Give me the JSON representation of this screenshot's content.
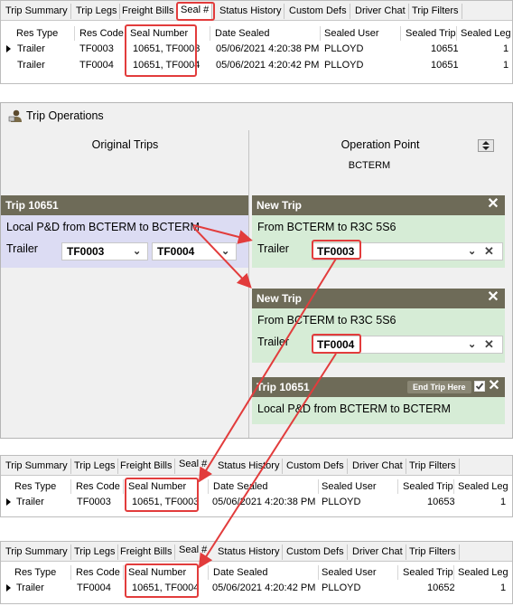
{
  "tabs": [
    "Trip Summary",
    "Trip Legs",
    "Freight Bills",
    "Seal #",
    "Status History",
    "Custom Defs",
    "Driver Chat",
    "Trip Filters"
  ],
  "columns": [
    "Res Type",
    "Res Code",
    "Seal Number",
    "Date Sealed",
    "Sealed User",
    "Sealed Trip",
    "Sealed Leg"
  ],
  "top_grid": {
    "rows": [
      {
        "res_type": "Trailer",
        "res_code": "TF0003",
        "seal_number": "10651, TF0003",
        "date_sealed": "05/06/2021 4:20:38 PM",
        "sealed_user": "PLLOYD",
        "sealed_trip": "10651",
        "sealed_leg": "1"
      },
      {
        "res_type": "Trailer",
        "res_code": "TF0004",
        "seal_number": "10651, TF0004",
        "date_sealed": "05/06/2021 4:20:42 PM",
        "sealed_user": "PLLOYD",
        "sealed_trip": "10651",
        "sealed_leg": "1"
      }
    ]
  },
  "trip_operations": {
    "title": "Trip Operations",
    "original_trips_heading": "Original Trips",
    "operation_point_heading": "Operation Point",
    "operation_point_value": "BCTERM",
    "original_trip": {
      "title": "Trip 10651",
      "route": "Local P&D from BCTERM to BCTERM",
      "res_label": "Trailer",
      "trailer_a": "TF0003",
      "trailer_b": "TF0004"
    },
    "new_trip_1": {
      "title": "New Trip",
      "route": "From BCTERM to R3C 5S6",
      "res_label": "Trailer",
      "trailer": "TF0003"
    },
    "new_trip_2": {
      "title": "New Trip",
      "route": "From BCTERM to R3C 5S6",
      "res_label": "Trailer",
      "trailer": "TF0004"
    },
    "end_trip": {
      "title": "Trip 10651",
      "end_trip_here_label": "End Trip Here",
      "route": "Local P&D from BCTERM to BCTERM"
    }
  },
  "grid2": {
    "row": {
      "res_type": "Trailer",
      "res_code": "TF0003",
      "seal_number": "10651, TF0003",
      "date_sealed": "05/06/2021 4:20:38 PM",
      "sealed_user": "PLLOYD",
      "sealed_trip": "10653",
      "sealed_leg": "1"
    }
  },
  "grid3": {
    "row": {
      "res_type": "Trailer",
      "res_code": "TF0004",
      "seal_number": "10651, TF0004",
      "date_sealed": "05/06/2021 4:20:42 PM",
      "sealed_user": "PLLOYD",
      "sealed_trip": "10652",
      "sealed_leg": "1"
    }
  },
  "colors": {
    "accent_red": "#e23c3c",
    "bar_olive": "#6e6b58",
    "card_green": "#d6ecd6",
    "card_blue": "#dcdcf3"
  },
  "icons": [
    "user-icon",
    "chevron-down-icon",
    "close-icon",
    "checkbox-checked-icon",
    "scroll-arrows-icon",
    "row-pointer-icon"
  ]
}
